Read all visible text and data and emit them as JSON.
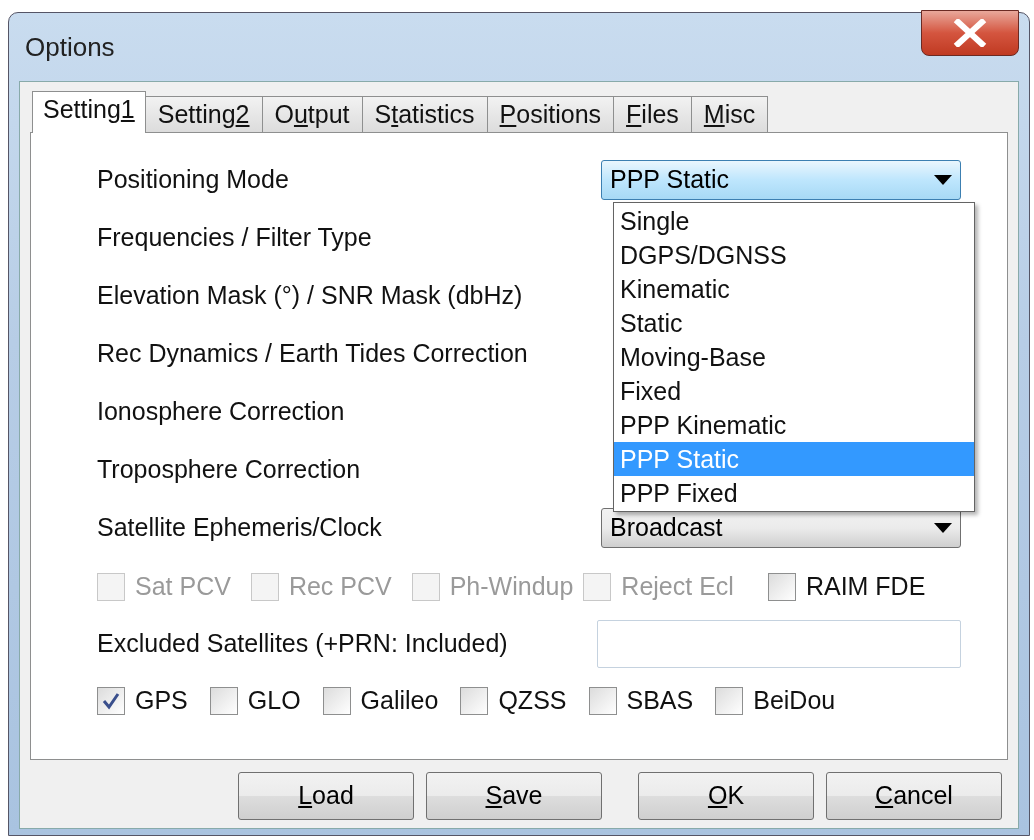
{
  "window": {
    "title": "Options"
  },
  "tabs": [
    {
      "pre": "Setting",
      "key": "1",
      "selected": true
    },
    {
      "pre": "Setting",
      "key": "2",
      "selected": false
    },
    {
      "pre": "O",
      "key": "u",
      "post": "tput",
      "selected": false
    },
    {
      "pre": "S",
      "key": "t",
      "post": "atistics",
      "selected": false
    },
    {
      "key": "P",
      "post": "ositions",
      "selected": false
    },
    {
      "key": "F",
      "post": "iles",
      "selected": false
    },
    {
      "key": "M",
      "post": "isc",
      "selected": false
    }
  ],
  "settings": [
    {
      "label": "Positioning Mode",
      "value": "PPP Static",
      "open": true
    },
    {
      "label": "Frequencies / Filter Type"
    },
    {
      "label": "Elevation Mask (°) / SNR Mask (dbHz)"
    },
    {
      "label": "Rec Dynamics / Earth Tides Correction"
    },
    {
      "label": "Ionosphere Correction"
    },
    {
      "label": "Troposphere Correction"
    },
    {
      "label": "Satellite Ephemeris/Clock",
      "value": "Broadcast",
      "open": false
    }
  ],
  "dropdown_list": [
    {
      "label": "Single",
      "selected": false
    },
    {
      "label": "DGPS/DGNSS",
      "selected": false
    },
    {
      "label": "Kinematic",
      "selected": false
    },
    {
      "label": "Static",
      "selected": false
    },
    {
      "label": "Moving-Base",
      "selected": false
    },
    {
      "label": "Fixed",
      "selected": false
    },
    {
      "label": "PPP Kinematic",
      "selected": false
    },
    {
      "label": "PPP Static",
      "selected": true
    },
    {
      "label": "PPP Fixed",
      "selected": false
    }
  ],
  "options": [
    {
      "label": "Sat PCV",
      "checked": false,
      "disabled": true
    },
    {
      "label": "Rec PCV",
      "checked": false,
      "disabled": true
    },
    {
      "label": "Ph-Windup",
      "checked": false,
      "disabled": true
    },
    {
      "label": "Reject Ecl",
      "checked": false,
      "disabled": true
    },
    {
      "label": "RAIM FDE",
      "checked": false,
      "disabled": false
    }
  ],
  "excluded_satellites": {
    "label": "Excluded Satellites (+PRN: Included)"
  },
  "systems": [
    {
      "label": "GPS",
      "checked": true
    },
    {
      "label": "GLO",
      "checked": false
    },
    {
      "label": "Galileo",
      "checked": false
    },
    {
      "label": "QZSS",
      "checked": false
    },
    {
      "label": "SBAS",
      "checked": false
    },
    {
      "label": "BeiDou",
      "checked": false
    }
  ],
  "buttons": [
    {
      "key": "L",
      "post": "oad"
    },
    {
      "key": "S",
      "post": "ave"
    },
    {
      "key": "O",
      "post": "K"
    },
    {
      "key": "C",
      "post": "ancel"
    }
  ]
}
